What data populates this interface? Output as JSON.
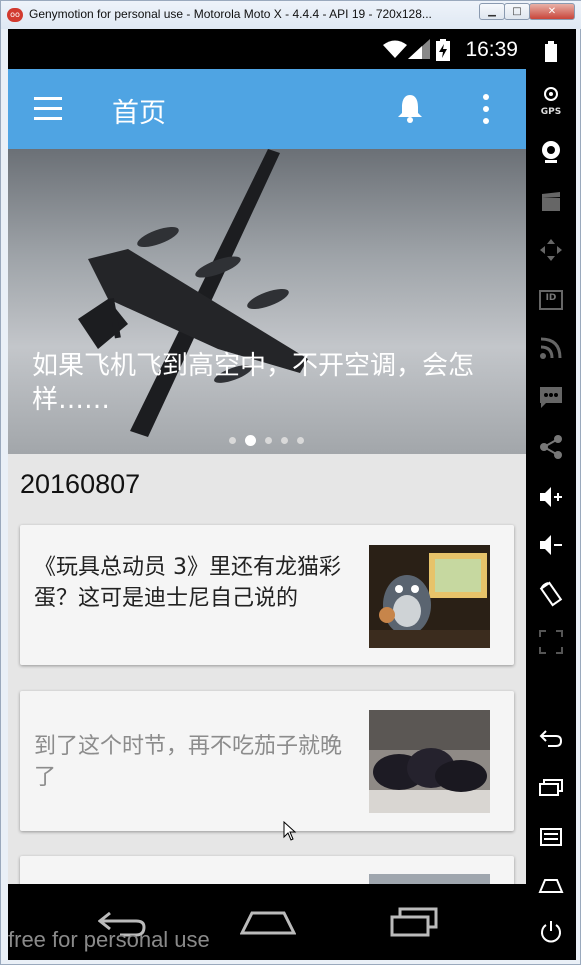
{
  "window": {
    "app_icon": "genymotion-logo-icon",
    "title": "Genymotion for personal use - Motorola Moto X - 4.4.4 - API 19 - 720x128..."
  },
  "status_bar": {
    "time": "16:39"
  },
  "toolbar": {
    "title": "首页",
    "menu_icon": "hamburger-menu-icon",
    "bell_icon": "bell-icon",
    "overflow_icon": "overflow-dots-icon"
  },
  "banner": {
    "caption": "如果飞机飞到高空中，不开空调，会怎样……",
    "slides_count": 5,
    "active_slide": 2
  },
  "feed": {
    "date": "20160807",
    "cards": [
      {
        "title": "《玩具总动员 3》里还有龙猫彩蛋？这可是迪士尼自己说的"
      },
      {
        "title": "到了这个时节，再不吃茄子就晚了"
      },
      {
        "title": ""
      }
    ]
  },
  "emulator_sidebar": {
    "gps_label": "GPS",
    "id_label": "ID"
  },
  "watermark": "free for personal use",
  "colors": {
    "toolbar": "#4fa4e3",
    "feed_background": "#e6e6e6",
    "card_background": "#f5f5f5"
  }
}
